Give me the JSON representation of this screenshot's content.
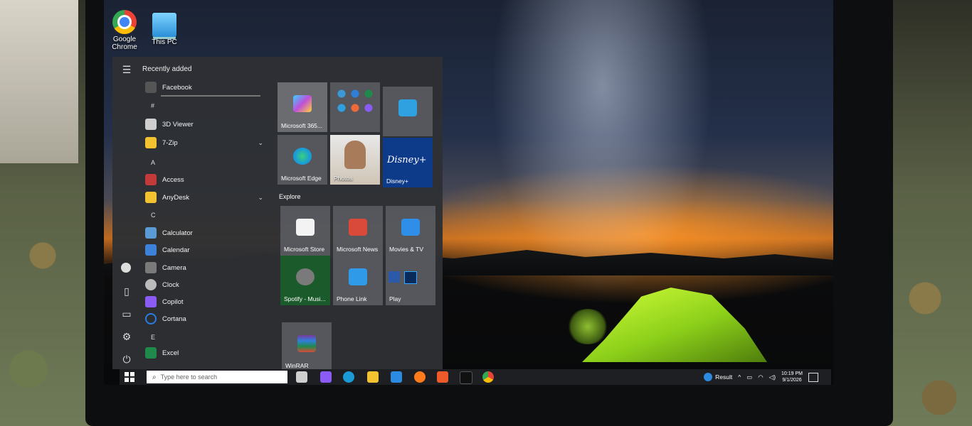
{
  "desktop": {
    "icons": [
      {
        "label": "Google\nChrome",
        "icon": "chrome-icon"
      },
      {
        "label": "This PC",
        "icon": "computer-icon"
      }
    ]
  },
  "start_menu": {
    "recently_added_heading": "Recently added",
    "recent_app": "Facebook",
    "letters": [
      "#",
      "A",
      "C",
      "E"
    ],
    "apps": [
      {
        "label": "3D Viewer",
        "color": "#cfcfcf"
      },
      {
        "label": "7-Zip",
        "color": "#f2c230",
        "expand": true
      },
      {
        "label": "Access",
        "color": "#c33a3a"
      },
      {
        "label": "AnyDesk",
        "color": "#f2c230",
        "expand": true
      },
      {
        "label": "Calculator",
        "color": "#5a9bd5"
      },
      {
        "label": "Calendar",
        "color": "#3b82d8"
      },
      {
        "label": "Camera",
        "color": "#7a7a7a"
      },
      {
        "label": "Clock",
        "color": "#bbbbbb"
      },
      {
        "label": "Copilot",
        "color": "#8a5cf5"
      },
      {
        "label": "Cortana",
        "color": "#2a7ce0"
      },
      {
        "label": "Excel",
        "color": "#1f8a4c"
      }
    ],
    "tiles": [
      {
        "label": "Microsoft 365...",
        "color": "#6a6c70",
        "glyph": "#c04fd9"
      },
      {
        "label": "",
        "color": "#5c5e62",
        "glyph": "#3a9ad9"
      },
      {
        "label": "",
        "color": "#5c5e62",
        "glyph": "#2fa0e0"
      },
      {
        "label": "Microsoft Edge",
        "color": "#5c5e62",
        "glyph": "#1a9bd7"
      },
      {
        "label": "Photos",
        "color": "#d8d8d8",
        "glyph": "#b08060"
      },
      {
        "label": "Disney+",
        "color": "#0e3a8a",
        "glyph": "#ffffff"
      }
    ],
    "explore_label": "Explore",
    "explore_tiles": [
      {
        "label": "Microsoft Store",
        "color": "#5c5e62",
        "glyph": "#f3f3f3"
      },
      {
        "label": "Microsoft News",
        "color": "#5c5e62",
        "glyph": "#d94a3a"
      },
      {
        "label": "Movies & TV",
        "color": "#5c5e62",
        "glyph": "#2f8ee8"
      },
      {
        "label": "Spotify - Musi...",
        "color": "#1b5a2a",
        "glyph": "#7a7a7a"
      },
      {
        "label": "Phone Link",
        "color": "#5c5e62",
        "glyph": "#2f9ae8"
      },
      {
        "label": "Play",
        "color": "#5c5e62",
        "glyph": "#2a5aa8"
      }
    ],
    "extra_tile": {
      "label": "WinRAR",
      "color": "#5c5e62",
      "glyph": "#7a3aa0"
    }
  },
  "taskbar": {
    "search_placeholder": "Type here to search",
    "pinned": [
      {
        "icon": "task-view-icon",
        "color": "#cfcfcf"
      },
      {
        "icon": "copilot-icon",
        "color": "#8a5cf5"
      },
      {
        "icon": "edge-icon",
        "color": "#1a9bd7"
      },
      {
        "icon": "file-explorer-icon",
        "color": "#f2c230"
      },
      {
        "icon": "mail-icon",
        "color": "#2a8be0"
      },
      {
        "icon": "firefox-icon",
        "color": "#ff7a1a"
      },
      {
        "icon": "anydesk-icon",
        "color": "#ef5a2a"
      },
      {
        "icon": "tiktok-icon",
        "color": "#111111"
      },
      {
        "icon": "chrome-icon",
        "color": "#34a853"
      }
    ],
    "weather_text": "Result",
    "time": "10:19 PM",
    "date": "9/1/2026"
  }
}
